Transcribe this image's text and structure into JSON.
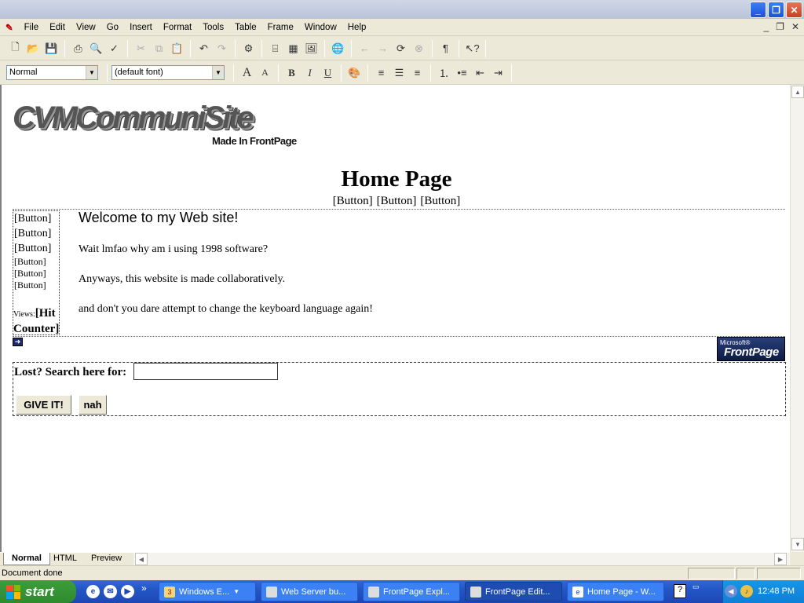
{
  "app": {
    "menu": [
      "File",
      "Edit",
      "View",
      "Go",
      "Insert",
      "Format",
      "Tools",
      "Table",
      "Frame",
      "Window",
      "Help"
    ]
  },
  "toolbar": {
    "style_value": "Normal",
    "font_value": "(default font)",
    "icons": [
      "new",
      "open",
      "save",
      "print",
      "print-preview",
      "spelling",
      "cut",
      "copy",
      "paste",
      "undo",
      "redo",
      "web",
      "frame",
      "table",
      "image",
      "link",
      "back",
      "forward",
      "refresh",
      "stop",
      "show-all",
      "help"
    ]
  },
  "page": {
    "logo_text": "CVMCommuniSite",
    "made_in": "Made In FrontPage",
    "title": "Home Page",
    "nav_buttons": [
      "[Button]",
      "[Button]",
      "[Button]"
    ],
    "sidebar_buttons": [
      "[Button]",
      "[Button]",
      "[Button]",
      "[Button]",
      "[Button]",
      "[Button]"
    ],
    "views_label": "Views:",
    "hit_counter": "[Hit Counter]",
    "welcome": "Welcome to my Web site!",
    "paragraphs": [
      "Wait lmfao why am i using 1998 software?",
      "Anyways, this website is made collaboratively.",
      "and don't you dare attempt to change the keyboard language again!"
    ],
    "badge_small": "Microsoft®",
    "badge_big": "FrontPage",
    "search_label": "Lost? Search here for:",
    "search_value": "",
    "submit_label": "GIVE IT!",
    "reset_label": "nah"
  },
  "tabs": [
    "Normal",
    "HTML",
    "Preview"
  ],
  "status": {
    "text": "Document done"
  },
  "taskbar": {
    "start_label": "start",
    "tasks": [
      {
        "label": "Windows E...",
        "badge": "3"
      },
      {
        "label": "Web Server bu..."
      },
      {
        "label": "FrontPage Expl..."
      },
      {
        "label": "FrontPage Edit..."
      },
      {
        "label": "Home Page - W..."
      }
    ],
    "clock": "12:48 PM"
  }
}
